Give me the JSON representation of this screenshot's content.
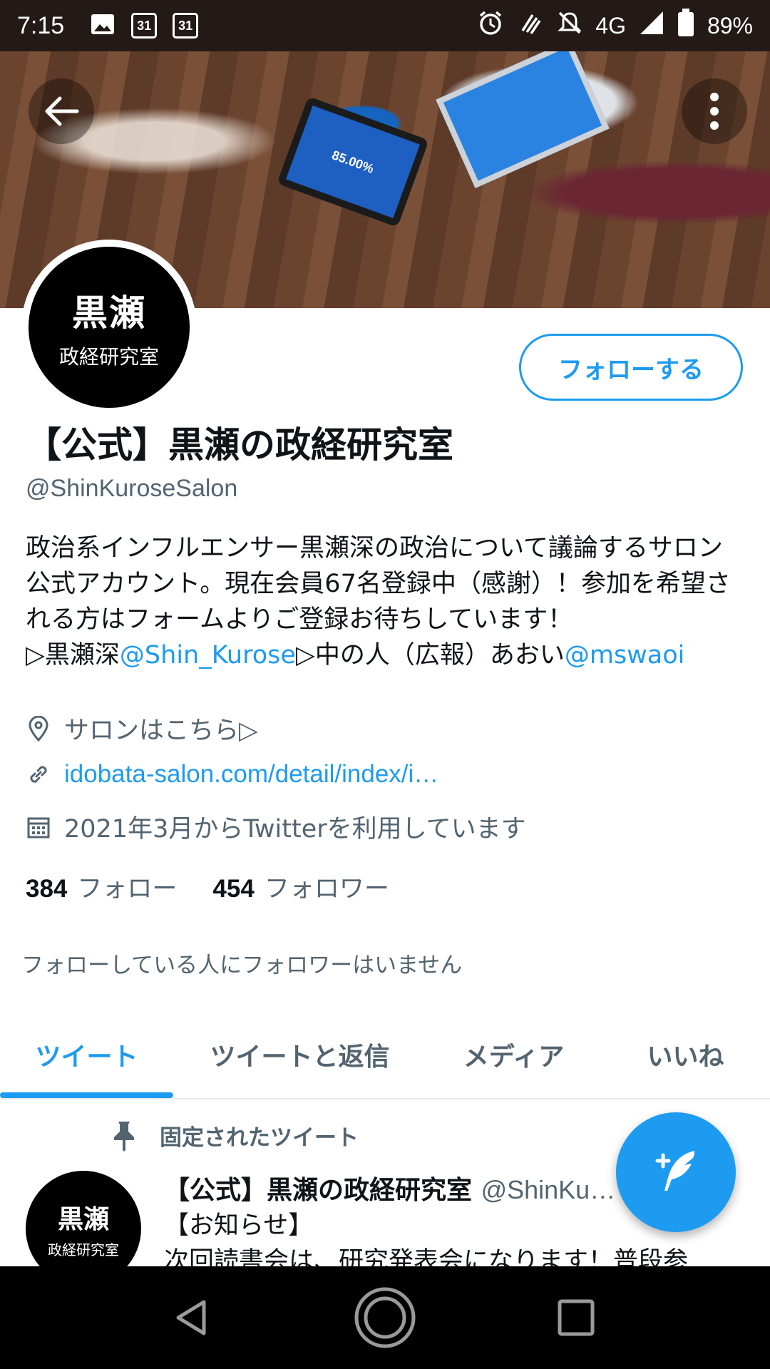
{
  "status_bar": {
    "time": "7:15",
    "calendar_1": "31",
    "calendar_2": "31",
    "network": "4G",
    "battery": "89%"
  },
  "banner": {
    "tablet_text": "85.00%"
  },
  "profile": {
    "avatar_line1": "黒瀬",
    "avatar_line2": "政経研究室",
    "follow_button": "フォローする",
    "name": "【公式】黒瀬の政経研究室",
    "handle": "@ShinKuroseSalon",
    "bio_text": "政治系インフルエンサー黒瀬深の政治について議論するサロン公式アカウント。現在会員67名登録中（感謝）！参加を希望される方はフォームよりご登録お待ちしています！",
    "bio_prefix": "▷黒瀬深",
    "bio_link1": "@Shin_Kurose",
    "bio_middle": "▷中の人（広報）あおい",
    "bio_link2": "@mswaoi",
    "location": "サロンはこちら▷",
    "website": "idobata-salon.com/detail/index/i…",
    "joined": "2021年3月からTwitterを利用しています",
    "following_count": "384",
    "following_label": "フォロー",
    "followers_count": "454",
    "followers_label": "フォロワー",
    "no_common_followers": "フォローしている人にフォロワーはいません"
  },
  "tabs": [
    {
      "label": "ツイート",
      "active": true
    },
    {
      "label": "ツイートと返信",
      "active": false
    },
    {
      "label": "メディア",
      "active": false
    },
    {
      "label": "いいね",
      "active": false
    }
  ],
  "pinned_tweet": {
    "pinned_label": "固定されたツイート",
    "avatar_line1": "黒瀬",
    "avatar_line2": "政経研究室",
    "author_name": "【公式】黒瀬の政経研究室",
    "author_handle": "@ShinKu…",
    "line1": "【お知らせ】",
    "line2": "次回読書会は、研究発表会になります！普段参"
  },
  "colors": {
    "accent": "#1d9bf0",
    "secondary_text": "#536471",
    "status_bar": "#231a17"
  }
}
